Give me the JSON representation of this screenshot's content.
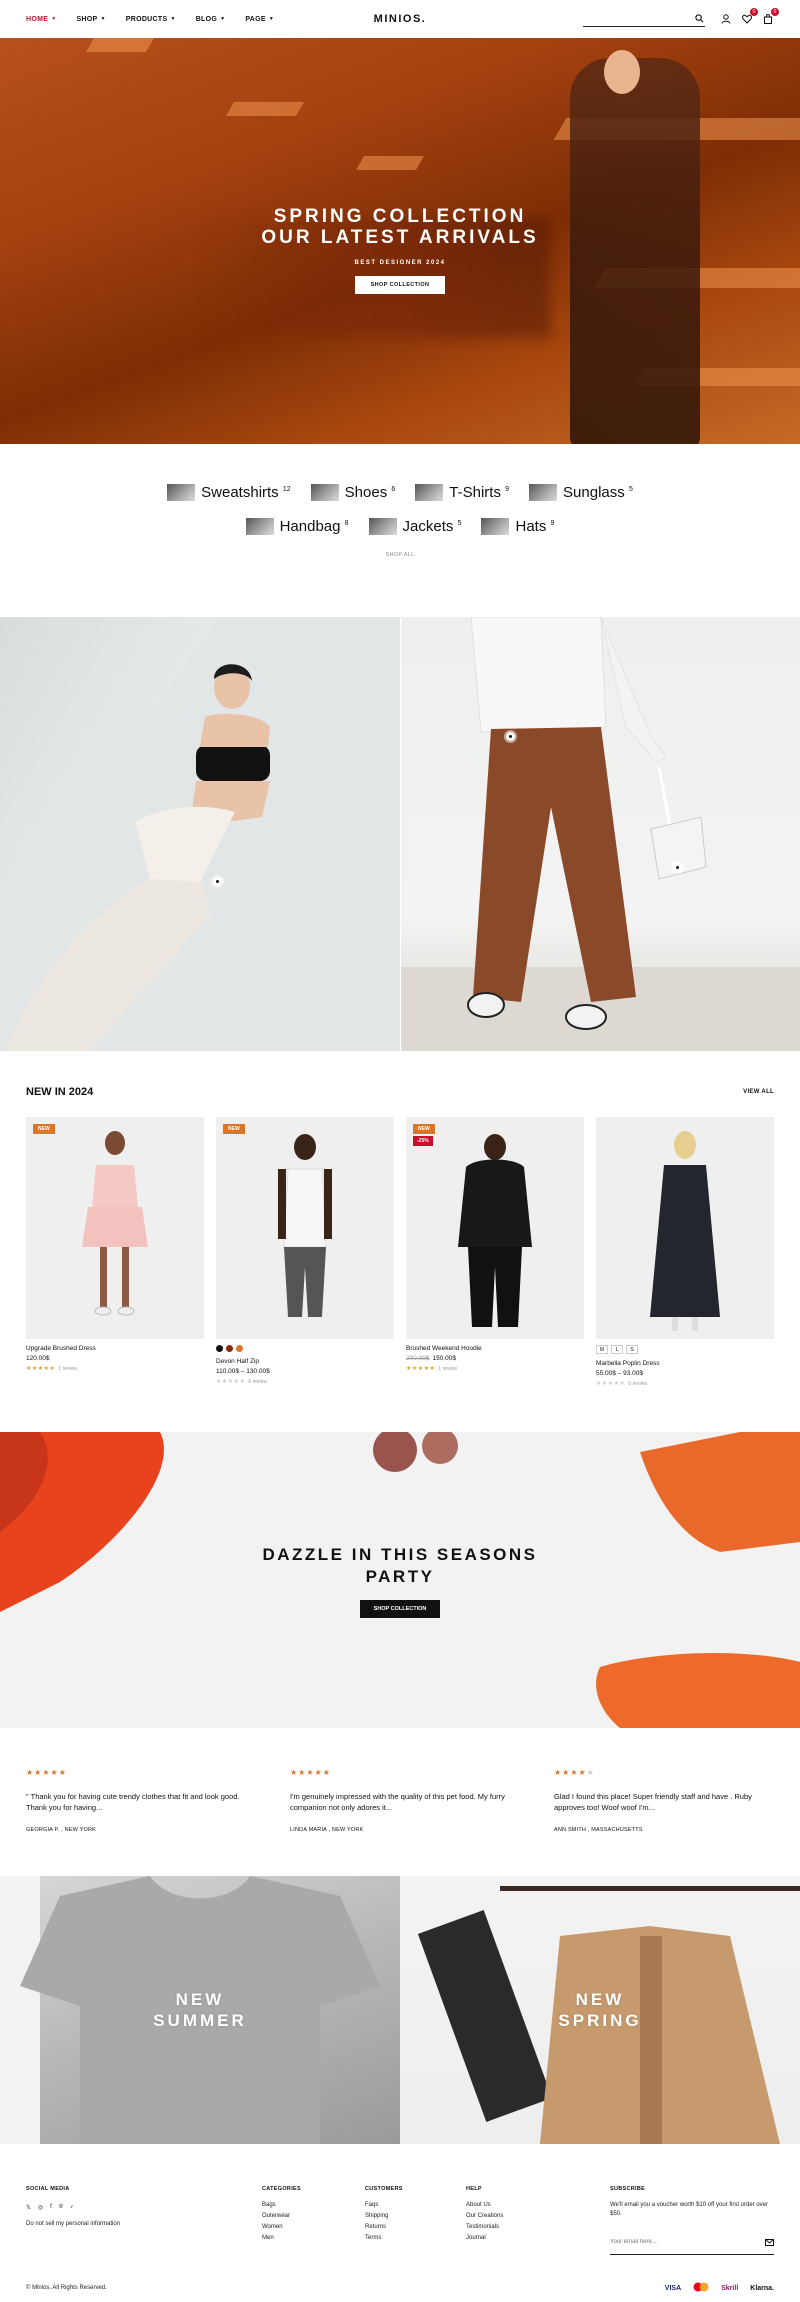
{
  "header": {
    "nav": [
      {
        "label": "HOME"
      },
      {
        "label": "SHOP"
      },
      {
        "label": "PRODUCTS"
      },
      {
        "label": "BLOG"
      },
      {
        "label": "PAGE"
      }
    ],
    "logo": "MINIOS.",
    "wishlist_count": "0",
    "cart_count": "0"
  },
  "hero": {
    "title_line1": "SPRING COLLECTION",
    "title_line2": "OUR LATEST ARRIVALS",
    "subtitle": "BEST DESIGNER 2024",
    "button": "SHOP COLLECTION"
  },
  "categories": {
    "row1": [
      {
        "label": "Sweatshirts",
        "count": "12"
      },
      {
        "label": "Shoes",
        "count": "6"
      },
      {
        "label": "T-Shirts",
        "count": "9"
      },
      {
        "label": "Sunglass",
        "count": "5"
      }
    ],
    "row2": [
      {
        "label": "Handbag",
        "count": "8"
      },
      {
        "label": "Jackets",
        "count": "5"
      },
      {
        "label": "Hats",
        "count": "9"
      }
    ],
    "shop_all": "SHOP ALL"
  },
  "new_in": {
    "title": "NEW IN 2024",
    "view_all": "VIEW ALL",
    "products": [
      {
        "tag": "NEW",
        "name": "Upgrade Brushed Dress",
        "price": "120.00$",
        "reviews": "1 review"
      },
      {
        "tag": "NEW",
        "name": "Devon Half Zip",
        "price": "110.00$ – 130.00$",
        "reviews": "0 review"
      },
      {
        "tag": "NEW",
        "tag2": "-25%",
        "name": "Brushed Weekend Hoodie",
        "old_price": "200.00$",
        "price": "150.00$",
        "reviews": "1 review"
      },
      {
        "name": "Marbella Poplin Dress",
        "price": "55.00$ – 93.00$",
        "sizes": [
          "M",
          "L",
          "S"
        ],
        "reviews": "0 review"
      }
    ],
    "swatch_colors": [
      "#111111",
      "#8a2a0a",
      "#d8772a"
    ]
  },
  "party": {
    "title_line1": "DAZZLE IN THIS SEASONS",
    "title_line2": "PARTY",
    "button": "SHOP COLLECTION"
  },
  "testimonials": [
    {
      "rating": 5,
      "text": "\" Thank you for having cute trendy clothes that fit and look good. Thank you for having...",
      "author": "GEORGIA P. , NEW YORK"
    },
    {
      "rating": 5,
      "text": "I'm genuinely impressed with the quality of this pet food. My furry companion not only adores it...",
      "author": "LINDA MARIA , NEW YORK"
    },
    {
      "rating": 4,
      "text": "Glad I found this place! Super friendly staff and have . Ruby approves too! Woof woof I'm...",
      "author": "ANN SMITH , MASSACHUSETTS"
    }
  ],
  "seasons": [
    {
      "line1": "NEW",
      "line2": "SUMMER"
    },
    {
      "line1": "NEW",
      "line2": "SPRING"
    }
  ],
  "footer": {
    "social_title": "SOCIAL MEDIA",
    "do_not_sell": "Do not sell my personal information",
    "categories_title": "CATEGORIES",
    "categories": [
      "Bags",
      "Outerwear",
      "Women",
      "Men"
    ],
    "customers_title": "CUSTOMERS",
    "customers": [
      "Faqs",
      "Shipping",
      "Returns",
      "Terms"
    ],
    "help_title": "HELP",
    "help": [
      "About Us",
      "Our Creations",
      "Testimonials",
      "Journal"
    ],
    "subscribe_title": "SUBSCRIBE",
    "subscribe_text": "We'll email you a voucher worth $10 off your first order over $50.",
    "email_placeholder": "Your email here...",
    "copyright": "© Minios. All Rights Reserved.",
    "payments": [
      "VISA",
      "Skrill",
      "Klarna."
    ]
  },
  "colors": {
    "accent": "#c8102e",
    "tag": "#d8772a",
    "hero": "#a3410f"
  }
}
